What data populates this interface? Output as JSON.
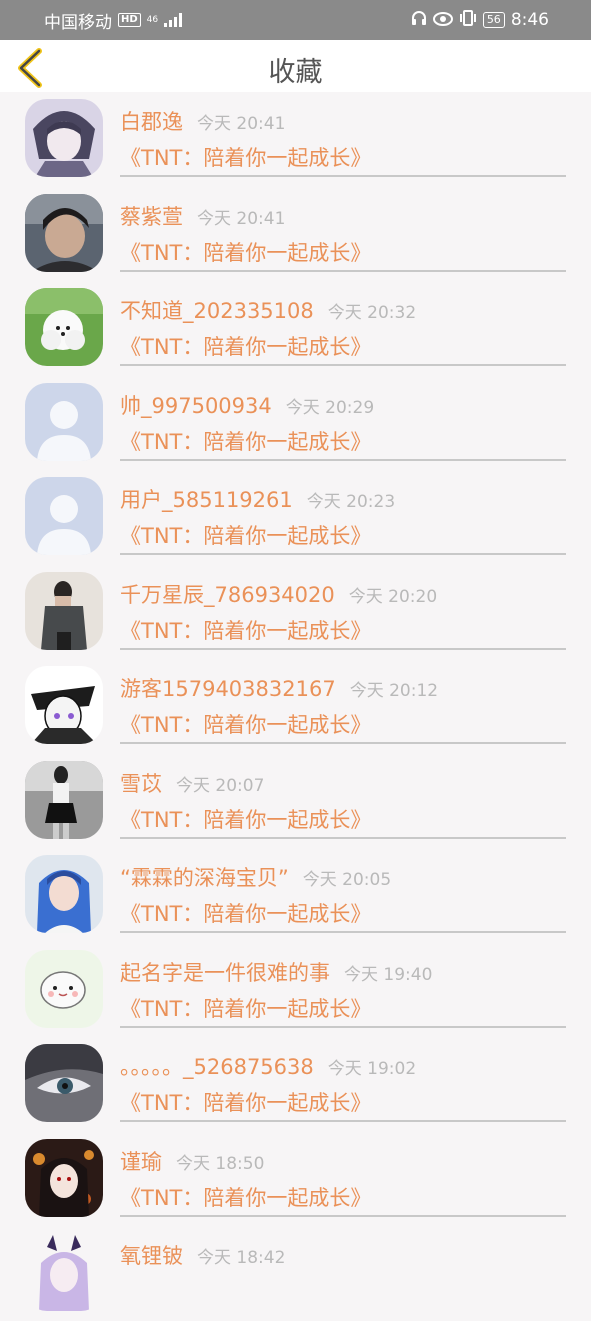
{
  "status_bar": {
    "carrier": "中国移动",
    "hd_label": "HD",
    "network": "46",
    "battery": "56",
    "time": "8:46"
  },
  "header": {
    "back_icon": "chevron-left-icon",
    "title": "收藏",
    "accent_color": "#f0c419"
  },
  "favorites": [
    {
      "name": "白郡逸",
      "time": "今天 20:41",
      "work": "《TNT：陪着你一起成长》",
      "avatar": "anime-boy"
    },
    {
      "name": "蔡紫萱",
      "time": "今天 20:41",
      "work": "《TNT：陪着你一起成长》",
      "avatar": "photo-boy"
    },
    {
      "name": "不知道_202335108",
      "time": "今天 20:32",
      "work": "《TNT：陪着你一起成长》",
      "avatar": "white-dog"
    },
    {
      "name": "帅_997500934",
      "time": "今天 20:29",
      "work": "《TNT：陪着你一起成长》",
      "avatar": "default-user"
    },
    {
      "name": "用户_585119261",
      "time": "今天 20:23",
      "work": "《TNT：陪着你一起成长》",
      "avatar": "default-user"
    },
    {
      "name": "千万星辰_786934020",
      "time": "今天 20:20",
      "work": "《TNT：陪着你一起成长》",
      "avatar": "photo-girl"
    },
    {
      "name": "游客1579403832167",
      "time": "今天 20:12",
      "work": "《TNT：陪着你一起成长》",
      "avatar": "anime-girl-hat"
    },
    {
      "name": "雪苡",
      "time": "今天 20:07",
      "work": "《TNT：陪着你一起成长》",
      "avatar": "bw-photo"
    },
    {
      "name": "“霖霖的深海宝贝”",
      "time": "今天 20:05",
      "work": "《TNT：陪着你一起成长》",
      "avatar": "blue-hair-girl"
    },
    {
      "name": "起名字是一件很难的事",
      "time": "今天 19:40",
      "work": "《TNT：陪着你一起成长》",
      "avatar": "hamster-cartoon"
    },
    {
      "name": "。。。。。_526875638",
      "time": "今天 19:02",
      "work": "《TNT：陪着你一起成长》",
      "avatar": "anime-eye"
    },
    {
      "name": "谨瑜",
      "time": "今天 18:50",
      "work": "《TNT：陪着你一起成长》",
      "avatar": "anime-dark-girl"
    },
    {
      "name": "氧锂铍",
      "time": "今天 18:42",
      "work": "",
      "avatar": "anime-horns"
    }
  ],
  "colors": {
    "name": "#ea9158",
    "time": "#b9b9b9",
    "divider": "#c8c8c8",
    "background": "#f7f5f6",
    "status_bar": "#8a8a8a"
  }
}
